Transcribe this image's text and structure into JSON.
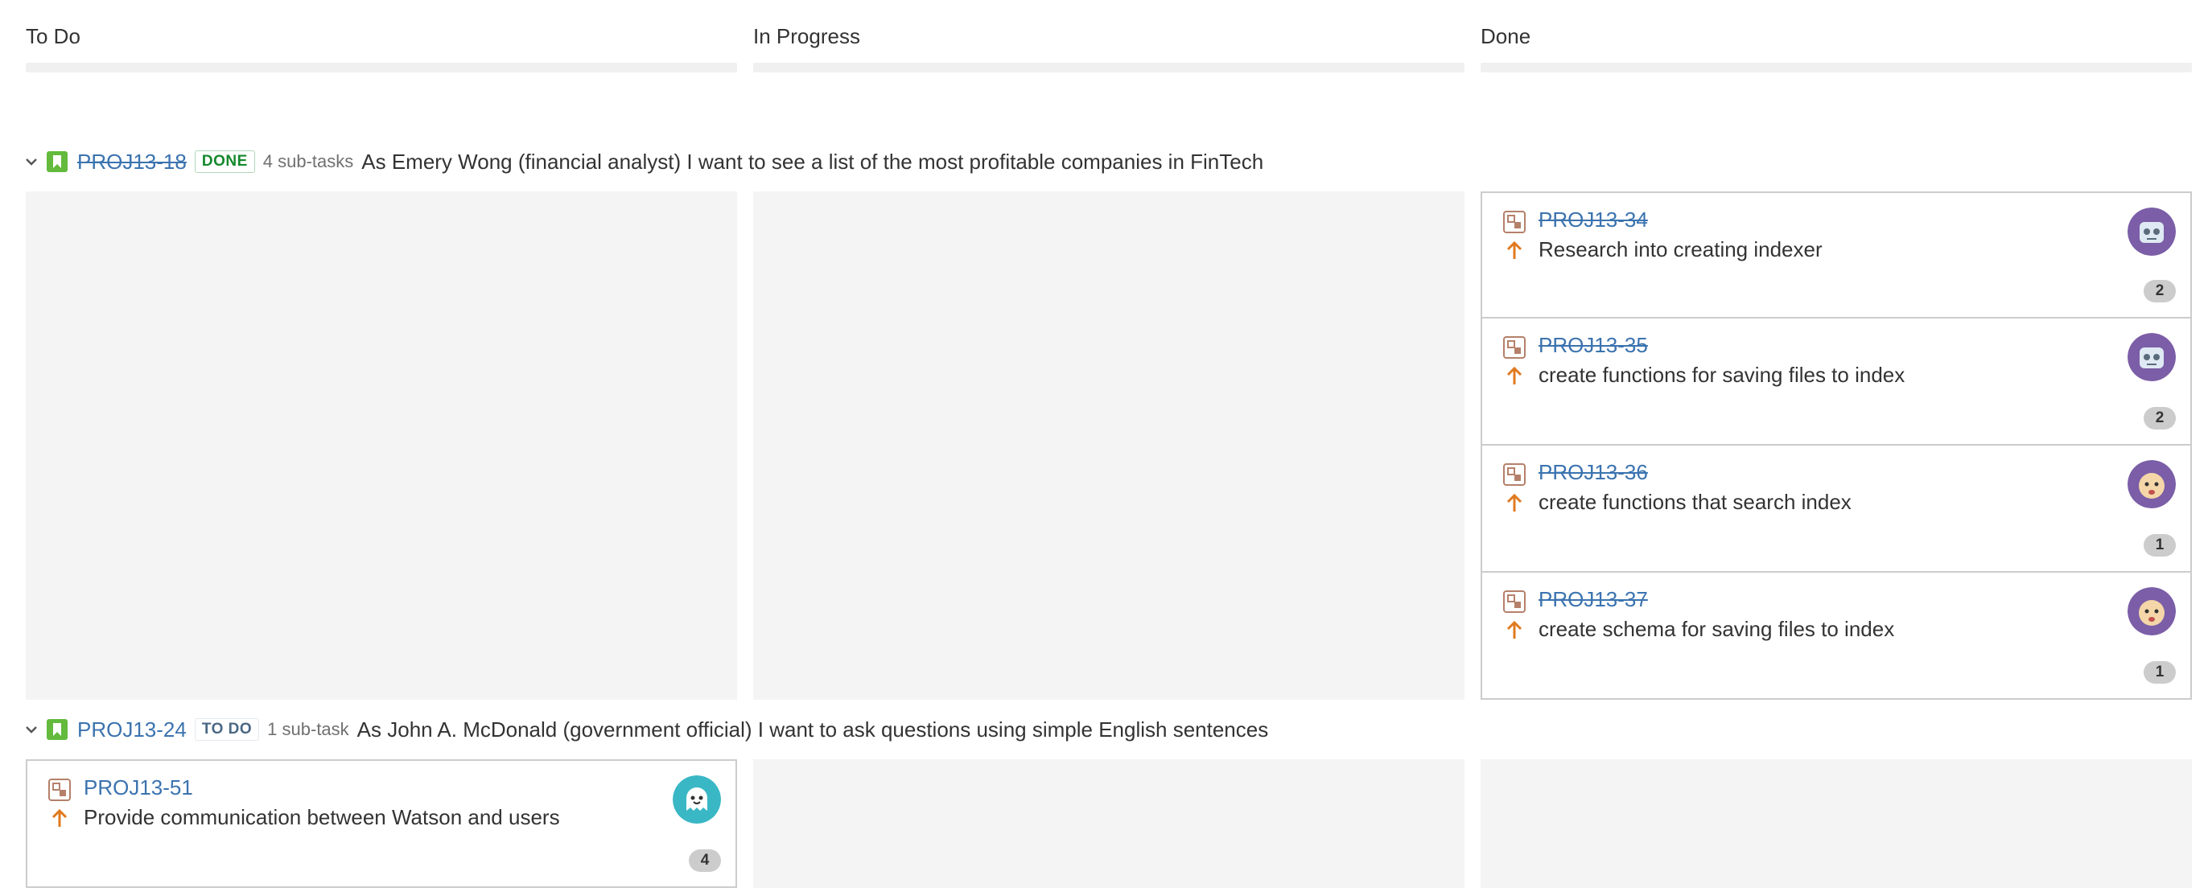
{
  "columns": [
    {
      "title": "To Do"
    },
    {
      "title": "In Progress"
    },
    {
      "title": "Done"
    }
  ],
  "colors": {
    "link": "#3b73af",
    "done_lozenge": "#14892c",
    "todo_lozenge": "#4a6785",
    "priority_arrow": "#e07a1f",
    "story_icon": "#63ba3c",
    "avatar_purple": "#7b5ea7",
    "avatar_teal": "#3ab7c5"
  },
  "swimlanes": [
    {
      "key": "PROJ13-18",
      "status": "DONE",
      "subtasks": "4 sub-tasks",
      "summary": "As Emery Wong (financial analyst) I want to see a list of the most profitable companies in FinTech",
      "icon": "story-icon",
      "cards": [
        {
          "key": "PROJ13-34",
          "summary": "Research into creating indexer",
          "estimate": "2",
          "avatar": "robot-avatar",
          "type_icon": "subtask-icon",
          "priority_icon": "arrow-up-icon"
        },
        {
          "key": "PROJ13-35",
          "summary": "create functions for saving files to index",
          "estimate": "2",
          "avatar": "robot-avatar",
          "type_icon": "subtask-icon",
          "priority_icon": "arrow-up-icon"
        },
        {
          "key": "PROJ13-36",
          "summary": "create functions that search index",
          "estimate": "1",
          "avatar": "face-avatar",
          "type_icon": "subtask-icon",
          "priority_icon": "arrow-up-icon"
        },
        {
          "key": "PROJ13-37",
          "summary": "create schema for saving files to index",
          "estimate": "1",
          "avatar": "face-avatar",
          "type_icon": "subtask-icon",
          "priority_icon": "arrow-up-icon"
        }
      ]
    },
    {
      "key": "PROJ13-24",
      "status": "TO DO",
      "subtasks": "1 sub-task",
      "summary": "As John A. McDonald (government official) I want to ask questions using simple English sentences",
      "icon": "story-icon",
      "cards": [
        {
          "key": "PROJ13-51",
          "summary": "Provide communication between Watson and users",
          "estimate": "4",
          "avatar": "ghost-avatar",
          "type_icon": "subtask-icon",
          "priority_icon": "arrow-up-icon"
        }
      ]
    }
  ]
}
